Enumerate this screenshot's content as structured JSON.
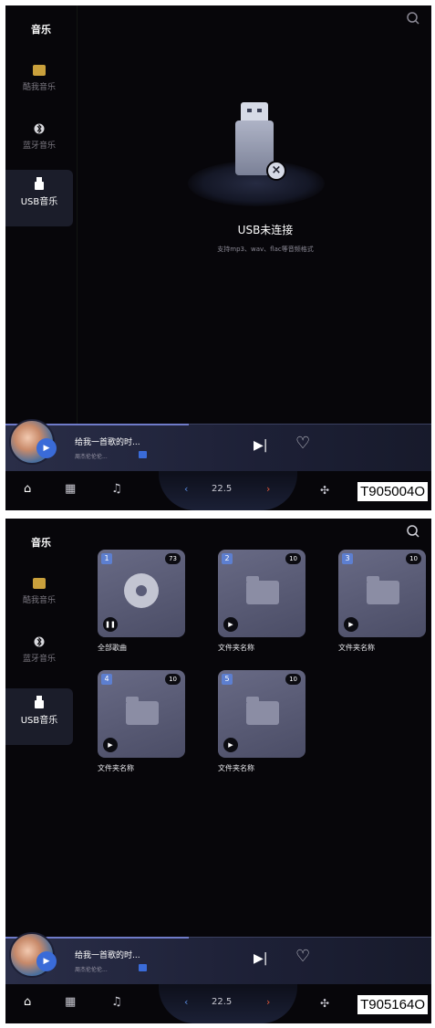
{
  "screens": [
    {
      "sidebar": {
        "title": "音乐",
        "items": [
          {
            "label": "酷我音乐"
          },
          {
            "label": "蓝牙音乐"
          },
          {
            "label": "USB音乐"
          }
        ]
      },
      "usb_state": {
        "title": "USB未连接",
        "subtitle": "支持mp3、wav、flac等音频格式"
      },
      "player": {
        "song": "给我一首歌的时...",
        "artist": "周杰伦伦伦...",
        "progress": 0.43
      },
      "nav": {
        "temperature": "22.5"
      },
      "figure_code": "T905004O"
    },
    {
      "sidebar": {
        "title": "音乐",
        "items": [
          {
            "label": "酷我音乐"
          },
          {
            "label": "蓝牙音乐"
          },
          {
            "label": "USB音乐"
          }
        ]
      },
      "folders": [
        {
          "index": "1",
          "count": "73",
          "label": "全部歌曲"
        },
        {
          "index": "2",
          "count": "10",
          "label": "文件夹名称"
        },
        {
          "index": "3",
          "count": "10",
          "label": "文件夹名称"
        },
        {
          "index": "4",
          "count": "10",
          "label": "文件夹名称"
        },
        {
          "index": "5",
          "count": "10",
          "label": "文件夹名称"
        }
      ],
      "player": {
        "song": "给我一首歌的时...",
        "artist": "周杰伦伦伦...",
        "progress": 0.43
      },
      "nav": {
        "temperature": "22.5"
      },
      "figure_code": "T905164O"
    }
  ],
  "icons": [
    "search-icon",
    "kuwo-icon",
    "bluetooth-icon",
    "usb-icon",
    "usb-drive-icon",
    "disc-icon",
    "folder-icon",
    "play-icon",
    "pause-icon",
    "next-icon",
    "heart-icon",
    "home-icon",
    "apps-icon",
    "music-note-icon",
    "fan-icon"
  ],
  "colors": {
    "background": "#07060a",
    "accent": "#3a6bd8",
    "card": "#5b5d78",
    "temp_left": "#5a8be0",
    "temp_right": "#e0573a"
  }
}
